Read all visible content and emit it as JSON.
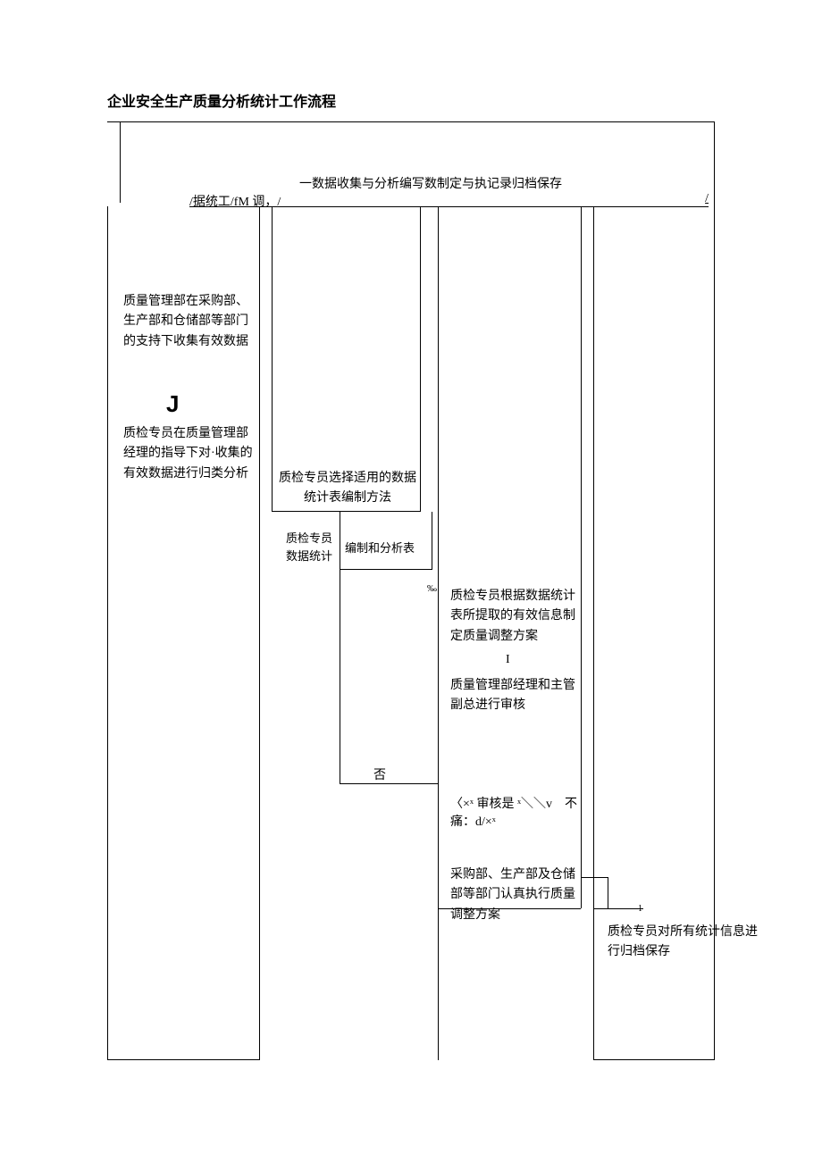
{
  "title": "企业安全生产质量分析统计工作流程",
  "header": {
    "line1": "一数据收集与分析编写数制定与执记录归档保存",
    "line2": "/据统工/fM 调，/",
    "rightSlash": "/"
  },
  "col1": {
    "box1": "质量管理部在采购部、生产部和仓储部等部门的支持下收集有效数据",
    "arrow": "J",
    "box2": "质检专员在质量管理部经理的指导下对·收集的有效数据进行归类分析"
  },
  "col2": {
    "box1": "质检专员选择适用的数据统计表编制方法",
    "sub1": "质检专员数据统计",
    "sub2": "编制和分析表",
    "percent": "‰",
    "fou": "否"
  },
  "col3": {
    "box1": "质检专员根据数据统计表所提取的有效信息制定质量调整方案",
    "i": "I",
    "box2": "质量管理部经理和主管副总进行审核",
    "box3": "〈×ˣ 审核是 ˣ＼＼v　不痛：d/×ˣ",
    "box4": "采购部、生产部及仓储部等部门认真执行质量调整方案",
    "small": "1"
  },
  "col4": {
    "box1": "质检专员对所有统计信息进行归档保存"
  }
}
